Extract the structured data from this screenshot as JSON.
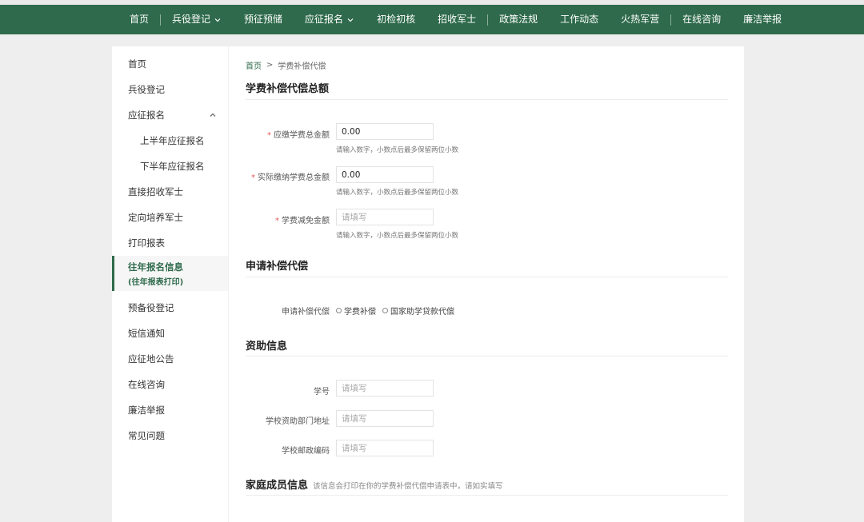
{
  "nav": {
    "items": [
      {
        "label": "首页",
        "dropdown": false
      },
      {
        "label": "兵役登记",
        "dropdown": true
      },
      {
        "label": "预征预储",
        "dropdown": false
      },
      {
        "label": "应征报名",
        "dropdown": true
      },
      {
        "label": "初检初核",
        "dropdown": false
      },
      {
        "label": "招收军士",
        "dropdown": false
      },
      {
        "label": "政策法规",
        "dropdown": false
      },
      {
        "label": "工作动态",
        "dropdown": false
      },
      {
        "label": "火热军营",
        "dropdown": false
      },
      {
        "label": "在线咨询",
        "dropdown": false
      },
      {
        "label": "廉洁举报",
        "dropdown": false
      }
    ]
  },
  "sidebar": {
    "items": [
      {
        "label": "首页"
      },
      {
        "label": "兵役登记"
      },
      {
        "label": "应征报名",
        "expanded": true
      },
      {
        "label": "上半年应征报名",
        "sub": true
      },
      {
        "label": "下半年应征报名",
        "sub": true
      },
      {
        "label": "直接招收军士"
      },
      {
        "label": "定向培养军士"
      },
      {
        "label": "打印报表"
      },
      {
        "label": "往年报名信息",
        "label2": "(往年报表打印)",
        "active": true
      },
      {
        "label": "预备役登记"
      },
      {
        "label": "短信通知"
      },
      {
        "label": "应征地公告"
      },
      {
        "label": "在线咨询"
      },
      {
        "label": "廉洁举报"
      },
      {
        "label": "常见问题"
      }
    ]
  },
  "breadcrumb": {
    "home": "首页",
    "sep": ">",
    "current": "学费补偿代偿"
  },
  "section1": {
    "title": "学费补偿代偿总额",
    "fields": [
      {
        "label": "应缴学费总金额",
        "required": true,
        "value": "0.00",
        "placeholder": "",
        "hint": "请输入数字，小数点后最多保留两位小数"
      },
      {
        "label": "实际缴纳学费总金额",
        "required": true,
        "value": "0.00",
        "placeholder": "",
        "hint": "请输入数字，小数点后最多保留两位小数"
      },
      {
        "label": "学费减免金额",
        "required": true,
        "value": "",
        "placeholder": "请填写",
        "hint": "请输入数字，小数点后最多保留两位小数"
      }
    ]
  },
  "section2": {
    "title": "申请补偿代偿",
    "label": "申请补偿代偿",
    "options": [
      "学费补偿",
      "国家助学贷款代偿"
    ]
  },
  "section3": {
    "title": "资助信息",
    "fields": [
      {
        "label": "学号",
        "placeholder": "请填写"
      },
      {
        "label": "学校资助部门地址",
        "placeholder": "请填写"
      },
      {
        "label": "学校邮政编码",
        "placeholder": "请填写"
      }
    ]
  },
  "section4": {
    "title": "家庭成员信息",
    "note": "该信息会打印在你的学费补偿代偿申请表中，请如实填写"
  },
  "colors": {
    "brand": "#2e6a4b",
    "required": "#e05a5a"
  }
}
